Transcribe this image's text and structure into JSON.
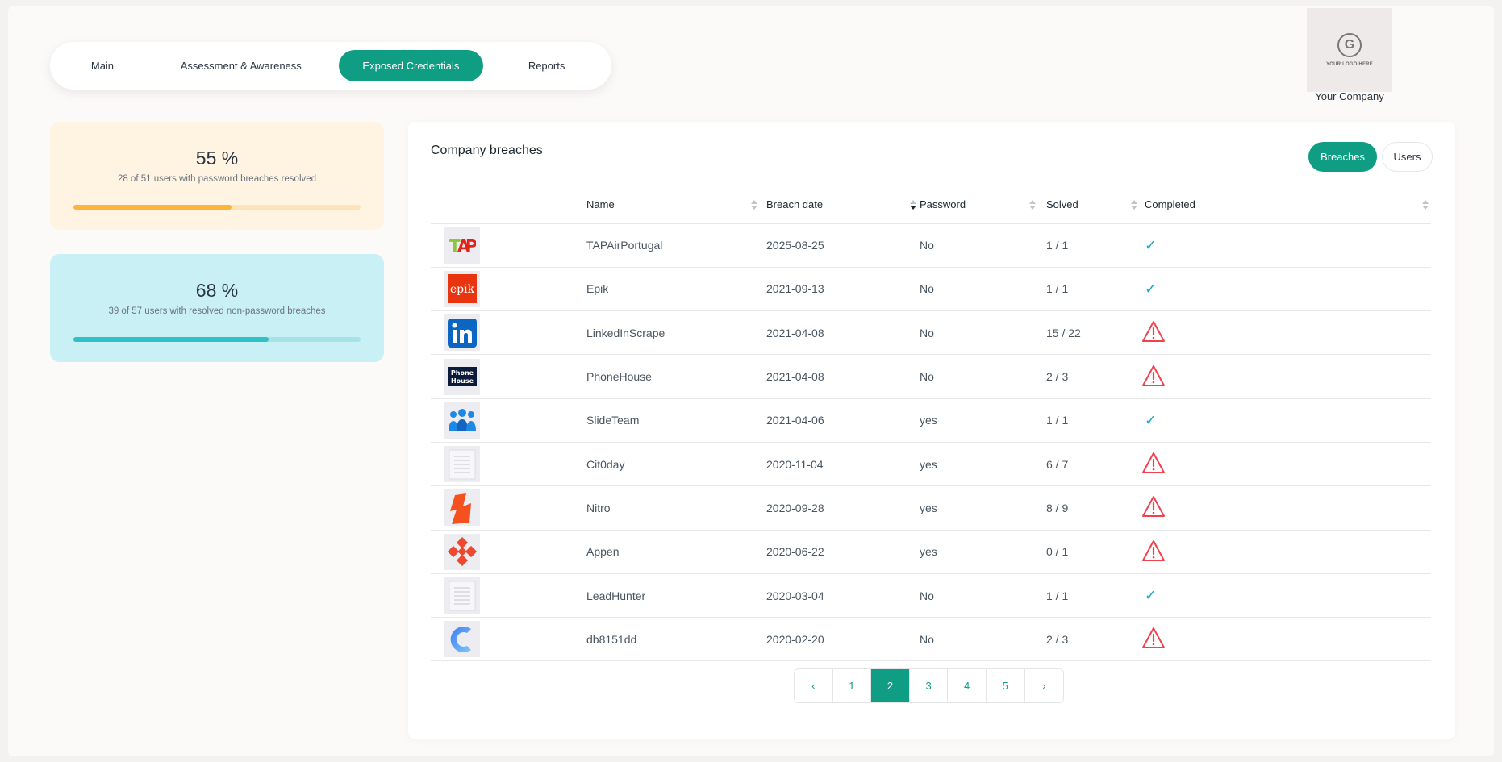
{
  "nav": {
    "tabs": [
      {
        "label": "Main",
        "active": false
      },
      {
        "label": "Assessment & Awareness",
        "active": false
      },
      {
        "label": "Exposed Credentials",
        "active": true
      },
      {
        "label": "Reports",
        "active": false
      }
    ]
  },
  "branding": {
    "logo_text": "YOUR LOGO HERE",
    "logo_letter": "G",
    "company_name": "Your Company"
  },
  "stats": [
    {
      "percent_label": "55 %",
      "description": "28 of 51 users with password breaches resolved",
      "progress": 0.55
    },
    {
      "percent_label": "68 %",
      "description": "39 of 57 users with resolved non-password breaches",
      "progress": 0.68
    }
  ],
  "panel": {
    "title": "Company breaches",
    "toggle": {
      "breaches_label": "Breaches",
      "users_label": "Users",
      "active": "Breaches"
    }
  },
  "table": {
    "columns": [
      "Name",
      "Breach date",
      "Password",
      "Solved",
      "Completed"
    ],
    "rows": [
      {
        "logo": "tap-logo",
        "name": "TAPAirPortugal",
        "date": "2025-08-25",
        "password": "No",
        "solved": "1 / 1",
        "completed": true
      },
      {
        "logo": "epik-logo",
        "name": "Epik",
        "date": "2021-09-13",
        "password": "No",
        "solved": "1 / 1",
        "completed": true
      },
      {
        "logo": "linkedin-logo",
        "name": "LinkedInScrape",
        "date": "2021-04-08",
        "password": "No",
        "solved": "15 / 22",
        "completed": false
      },
      {
        "logo": "phonehouse-logo",
        "name": "PhoneHouse",
        "date": "2021-04-08",
        "password": "No",
        "solved": "2 / 3",
        "completed": false
      },
      {
        "logo": "slideteam-logo",
        "name": "SlideTeam",
        "date": "2021-04-06",
        "password": "yes",
        "solved": "1 / 1",
        "completed": true
      },
      {
        "logo": "document-placeholder-icon",
        "name": "Cit0day",
        "date": "2020-11-04",
        "password": "yes",
        "solved": "6 / 7",
        "completed": false
      },
      {
        "logo": "nitro-logo",
        "name": "Nitro",
        "date": "2020-09-28",
        "password": "yes",
        "solved": "8 / 9",
        "completed": false
      },
      {
        "logo": "appen-logo",
        "name": "Appen",
        "date": "2020-06-22",
        "password": "yes",
        "solved": "0 / 1",
        "completed": false
      },
      {
        "logo": "document-placeholder-icon",
        "name": "LeadHunter",
        "date": "2020-03-04",
        "password": "No",
        "solved": "1 / 1",
        "completed": true
      },
      {
        "logo": "db8151dd-logo",
        "name": "db8151dd",
        "date": "2020-02-20",
        "password": "No",
        "solved": "2 / 3",
        "completed": false
      }
    ]
  },
  "pagination": {
    "prev_label": "‹",
    "next_label": "›",
    "pages": [
      "1",
      "2",
      "3",
      "4",
      "5"
    ],
    "current": "2"
  },
  "colors": {
    "accent": "#0f9e83",
    "check": "#1aa9c0",
    "warning": "#f0414e",
    "card_orange": "#fff3e1",
    "card_cyan": "#c9f0f5"
  }
}
